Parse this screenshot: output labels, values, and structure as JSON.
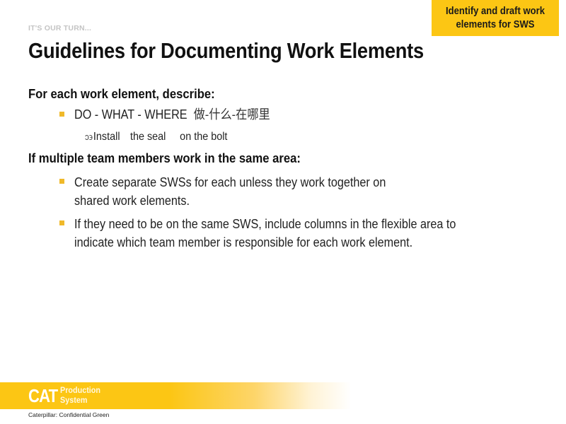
{
  "badge": {
    "line1": "Identify and draft work",
    "line2": "elements for SWS"
  },
  "kicker": "IT'S OUR TURN...",
  "title": "Guidelines for Documenting Work Elements",
  "sections": [
    {
      "heading": "For each work element, describe:",
      "bullets": [
        {
          "text": "DO - WHAT - WHERE",
          "cjk": "做-什么-在哪里",
          "sub": {
            "glyph": "ↄ϶",
            "parts": [
              "Install",
              "the seal",
              "on the bolt"
            ]
          }
        }
      ]
    },
    {
      "heading": "If multiple team members work in the same area:",
      "bullets": [
        {
          "lines": [
            "Create separate SWSs for each unless they work together on",
            "shared work elements."
          ]
        },
        {
          "lines": [
            "If they need to be on the same SWS, include columns in the flexible area to",
            "indicate which team member is responsible for each work element."
          ]
        }
      ]
    }
  ],
  "footer": {
    "logo_mark": "CAT",
    "logo_line1": "Production",
    "logo_line2": "System",
    "confidentiality": "Caterpillar: Confidential Green"
  },
  "colors": {
    "accent": "#fcc614",
    "bullet": "#f0b92a"
  }
}
